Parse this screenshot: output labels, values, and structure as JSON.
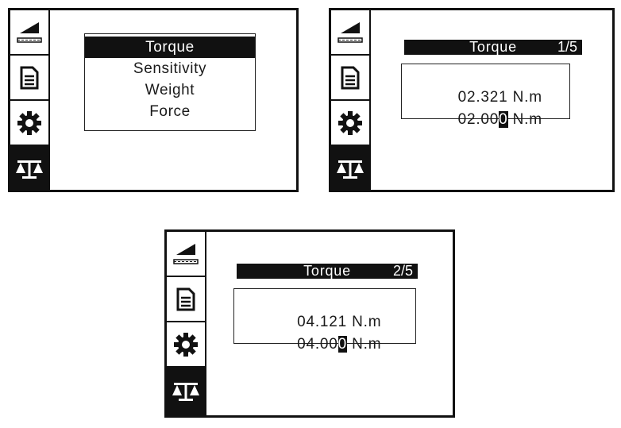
{
  "icons": {
    "tab1": "angle-ruler-icon",
    "tab2": "document-icon",
    "tab3": "gear-icon",
    "tab4": "balance-scale-icon"
  },
  "colors": {
    "ink": "#111111",
    "paper": "#ffffff"
  },
  "screen1": {
    "menu": [
      {
        "label": "Torque",
        "selected": true
      },
      {
        "label": "Sensitivity",
        "selected": false
      },
      {
        "label": "Weight",
        "selected": false
      },
      {
        "label": "Force",
        "selected": false
      }
    ]
  },
  "screen2": {
    "title": "Torque",
    "page": "1/5",
    "measured": "02.321",
    "measured_unit": "N.m",
    "setpoint_prefix": "02.00",
    "setpoint_cursor": "0",
    "setpoint_unit": "N.m"
  },
  "screen3": {
    "title": "Torque",
    "page": "2/5",
    "measured": "04.121",
    "measured_unit": "N.m",
    "setpoint_prefix": "04.00",
    "setpoint_cursor": "0",
    "setpoint_unit": "N.m"
  }
}
